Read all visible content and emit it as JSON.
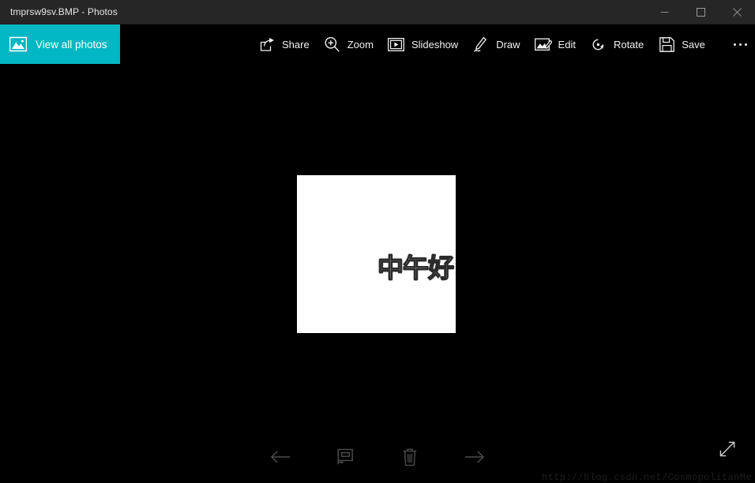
{
  "window": {
    "title": "tmprsw9sv.BMP - Photos",
    "controls": {
      "minimize": "minimize-icon",
      "maximize": "maximize-icon",
      "close": "close-icon"
    },
    "colors": {
      "titlebar_bg": "#262626",
      "app_bg": "#000000",
      "accent_teal": "#00b7c3",
      "text": "#f2f2f2"
    }
  },
  "command_bar": {
    "view_all_photos": {
      "label": "View all photos",
      "icon": "photos-mountain-icon"
    },
    "tools": [
      {
        "label": "Share",
        "icon": "share-icon"
      },
      {
        "label": "Zoom",
        "icon": "zoom-magnifier-icon"
      },
      {
        "label": "Slideshow",
        "icon": "slideshow-icon"
      },
      {
        "label": "Draw",
        "icon": "draw-pen-icon"
      },
      {
        "label": "Edit",
        "icon": "edit-image-icon"
      },
      {
        "label": "Rotate",
        "icon": "rotate-icon"
      },
      {
        "label": "Save",
        "icon": "save-floppy-icon"
      }
    ],
    "more_label": "See more",
    "more_icon": "ellipsis-icon"
  },
  "photo": {
    "background": "#ffffff",
    "text": "中午好",
    "text_style": "outlined"
  },
  "bottom_bar": {
    "buttons": [
      {
        "name": "previous",
        "icon": "arrow-left-icon"
      },
      {
        "name": "fit-to-window",
        "icon": "fit-to-window-icon"
      },
      {
        "name": "delete",
        "icon": "trash-icon"
      },
      {
        "name": "next",
        "icon": "arrow-right-icon"
      }
    ],
    "fullscreen_icon": "fullscreen-diagonal-arrows-icon"
  },
  "watermark": {
    "text": "http://blog.csdn.net/CosmopolitanMe"
  }
}
